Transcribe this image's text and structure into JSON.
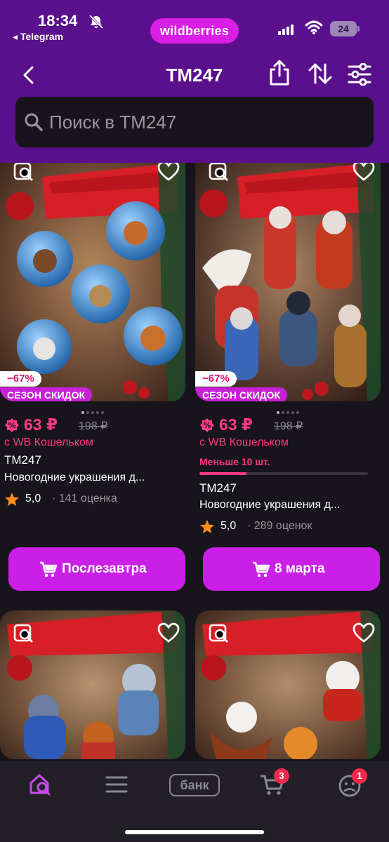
{
  "status_bar": {
    "time": "18:34",
    "back_app": "◂ Telegram",
    "brand": "wildberries",
    "battery": "24"
  },
  "header": {
    "title": "TM247",
    "search_placeholder": "Поиск в TM247"
  },
  "products": [
    {
      "discount": "−67%",
      "sale_label": "СЕЗОН СКИДОК",
      "price": "63 ₽",
      "old_price": "198 ₽",
      "wallet": "с WB Кошельком",
      "brand": "TM247",
      "name": "Новогодние украшения д...",
      "rating": "5,0",
      "reviews": "· 141 оценка",
      "delivery": "Послезавтра"
    },
    {
      "discount": "−67%",
      "sale_label": "СЕЗОН СКИДОК",
      "price": "63 ₽",
      "old_price": "198 ₽",
      "wallet": "с WB Кошельком",
      "stock": "Меньше 10 шт.",
      "stock_level": 0.28,
      "brand": "TM247",
      "name": "Новогодние украшения д...",
      "rating": "5,0",
      "reviews": "· 289 оценок",
      "delivery": "8 марта"
    }
  ],
  "tabbar": {
    "bank": "банк",
    "cart_badge": "3",
    "profile_badge": "1"
  },
  "colors": {
    "accent": "#cb1fe8",
    "header_bg": "#5a108c",
    "price": "#ff3a82"
  }
}
